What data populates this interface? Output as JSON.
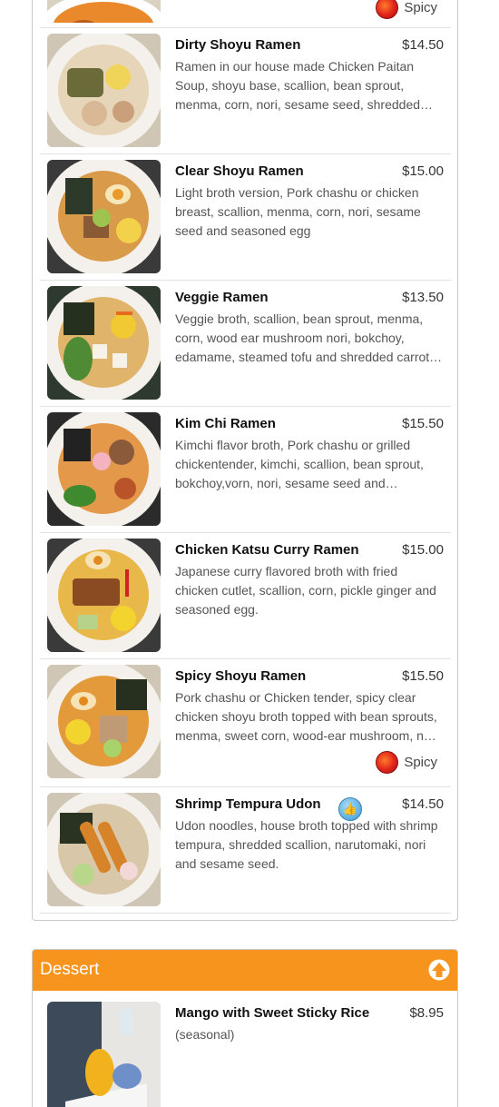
{
  "top_item": {
    "tag": "Spicy"
  },
  "ramen_items": [
    {
      "name": "Dirty Shoyu Ramen",
      "price": "$14.50",
      "desc": "Ramen in our house made Chicken Paitan Soup, shoyu base, scallion, bean sprout, menma, corn, nori, sesame seed, shredded…"
    },
    {
      "name": "Clear Shoyu Ramen",
      "price": "$15.00",
      "desc": "Light broth version, Pork chashu or chicken breast, scallion, menma, corn, nori, sesame seed and seasoned egg"
    },
    {
      "name": "Veggie Ramen",
      "price": "$13.50",
      "desc": "Veggie broth, scallion, bean sprout, menma, corn, wood ear mushroom nori, bokchoy, edamame, steamed tofu and shredded carrot…"
    },
    {
      "name": "Kim Chi Ramen",
      "price": "$15.50",
      "desc": "Kimchi flavor broth, Pork chashu or grilled chickentender, kimchi, scallion, bean sprout, bokchoy,vorn, nori, sesame seed and…"
    },
    {
      "name": "Chicken Katsu Curry Ramen",
      "price": "$15.00",
      "desc": "Japanese curry flavored broth with fried chicken cutlet, scallion, corn, pickle ginger and seasoned egg."
    },
    {
      "name": "Spicy Shoyu Ramen",
      "price": "$15.50",
      "desc": "Pork chashu or Chicken tender, spicy clear chicken shoyu broth topped with bean sprouts, menma, sweet corn, wood-ear mushroom, n…",
      "tag": "Spicy"
    },
    {
      "name": "Shrimp Tempura Udon",
      "price": "$14.50",
      "desc": "Udon noodles, house broth topped with shrimp tempura, shredded scallion, narutomaki, nori and sesame seed."
    }
  ],
  "dessert": {
    "title": "Dessert",
    "items": [
      {
        "name": "Mango with Sweet Sticky Rice",
        "price": "$8.95",
        "desc": "(seasonal)"
      }
    ]
  },
  "icons": {
    "spicy": "pepper-icon",
    "recommended": "thumbs-up-icon",
    "back_to_top": "arrow-up-icon"
  },
  "colors": {
    "accent": "#f7941d",
    "spicy": "#e0231b"
  }
}
